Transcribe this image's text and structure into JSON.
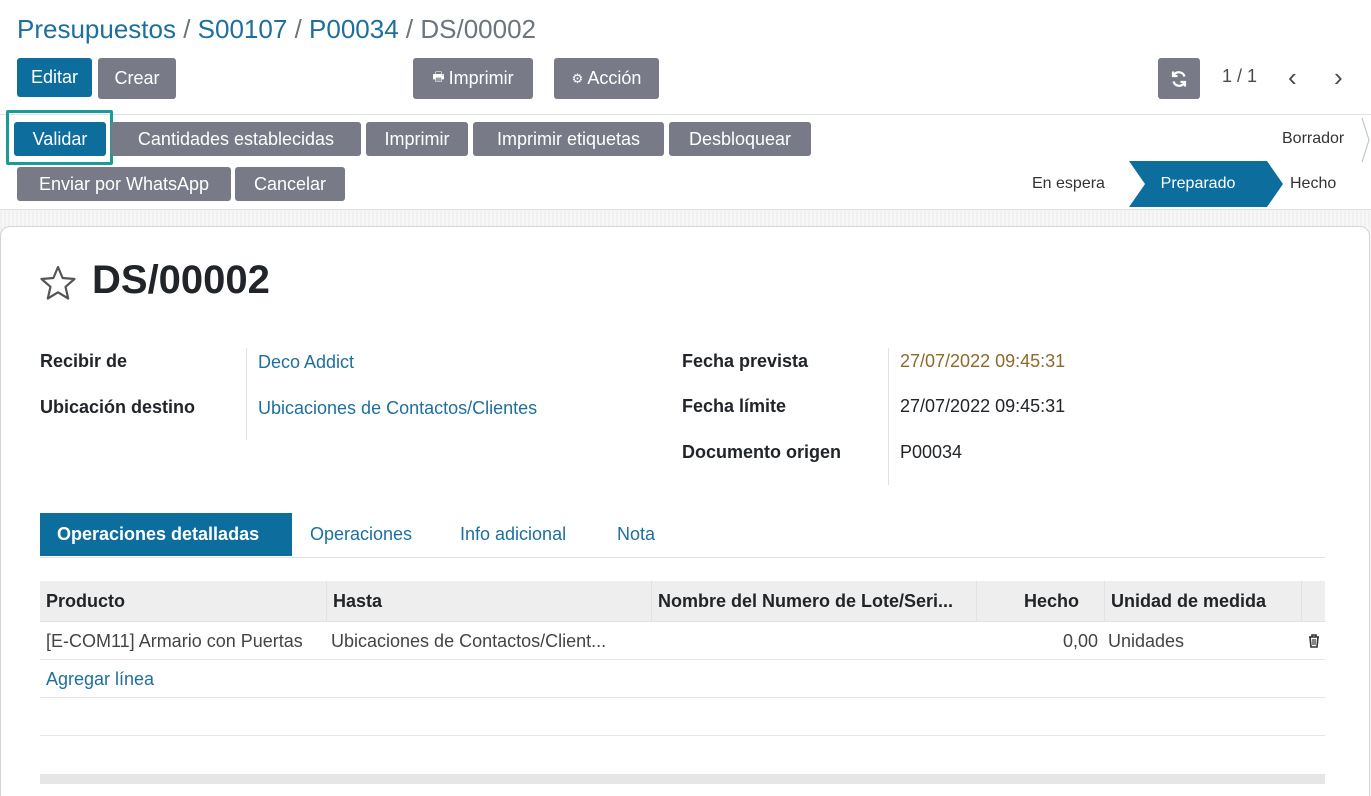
{
  "breadcrumb": {
    "items": [
      "Presupuestos",
      "S00107",
      "P00034"
    ],
    "separator": "/",
    "current": "DS/00002"
  },
  "toolbar": {
    "edit_label": "Editar",
    "create_label": "Crear",
    "print_label": "Imprimir",
    "action_label": "Acción",
    "pager": "1 / 1"
  },
  "statusbar": {
    "buttons": [
      "Validar",
      "Cantidades establecidas",
      "Imprimir",
      "Imprimir etiquetas",
      "Desbloquear",
      "Enviar por WhatsApp",
      "Cancelar"
    ],
    "stages": [
      "Borrador",
      "En espera",
      "Preparado",
      "Hecho"
    ],
    "active_stage": "Preparado"
  },
  "record": {
    "name": "DS/00002",
    "fields_left": [
      {
        "label": "Recibir de",
        "value": "Deco Addict"
      },
      {
        "label": "Ubicación destino",
        "value": "Ubicaciones de Contactos/Clientes"
      }
    ],
    "fields_right": [
      {
        "label": "Fecha prevista",
        "value": "27/07/2022 09:45:31"
      },
      {
        "label": "Fecha límite",
        "value": "27/07/2022 09:45:31"
      },
      {
        "label": "Documento origen",
        "value": "P00034"
      }
    ]
  },
  "tabs": [
    "Operaciones detalladas",
    "Operaciones",
    "Info adicional",
    "Nota"
  ],
  "table": {
    "headers": [
      "Producto",
      "Hasta",
      "Nombre del Numero de Lote/Seri...",
      "Hecho",
      "Unidad de medida"
    ],
    "rows": [
      {
        "product": "[E-COM11] Armario con Puertas",
        "to": "Ubicaciones de Contactos/Client...",
        "lot": "",
        "done": "0,00",
        "uom": "Unidades"
      }
    ],
    "add_line": "Agregar línea"
  },
  "colors": {
    "primary": "#0d6e9e",
    "secondary": "#787b87",
    "link": "#1f6f9e",
    "highlight": "#1a9b96",
    "warning_date": "#8d6a2c"
  }
}
